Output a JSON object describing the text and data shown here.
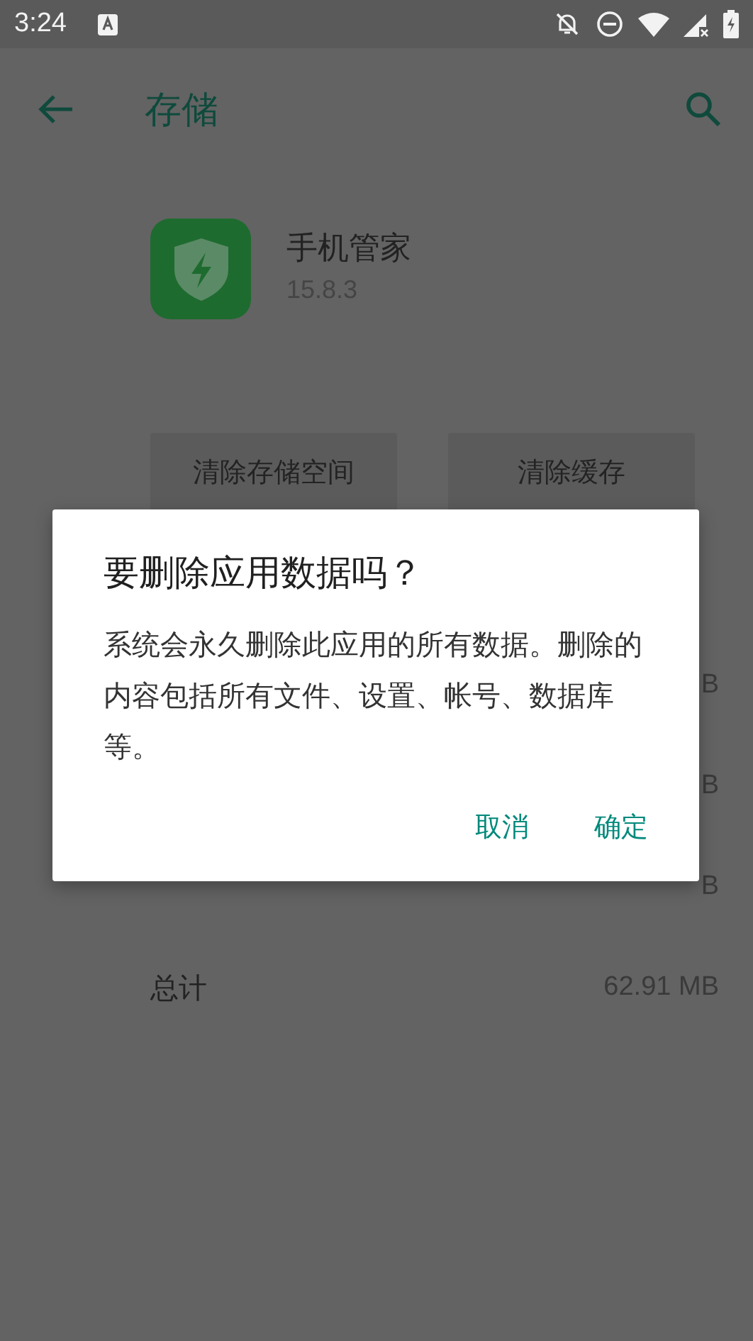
{
  "status_bar": {
    "time": "3:24"
  },
  "app_bar": {
    "title": "存储"
  },
  "app": {
    "name": "手机管家",
    "version": "15.8.3"
  },
  "actions": [
    {
      "label": "清除存储空间"
    },
    {
      "label": "清除缓存"
    }
  ],
  "rows": [
    {
      "value": "B"
    },
    {
      "value": "B"
    },
    {
      "value": "B"
    }
  ],
  "total": {
    "label": "总计",
    "value": "62.91 MB"
  },
  "dialog": {
    "title": "要删除应用数据吗？",
    "message": "系统会永久删除此应用的所有数据。删除的内容包括所有文件、设置、帐号、数据库等。",
    "buttons": [
      {
        "label": "取消"
      },
      {
        "label": "确定"
      }
    ]
  }
}
